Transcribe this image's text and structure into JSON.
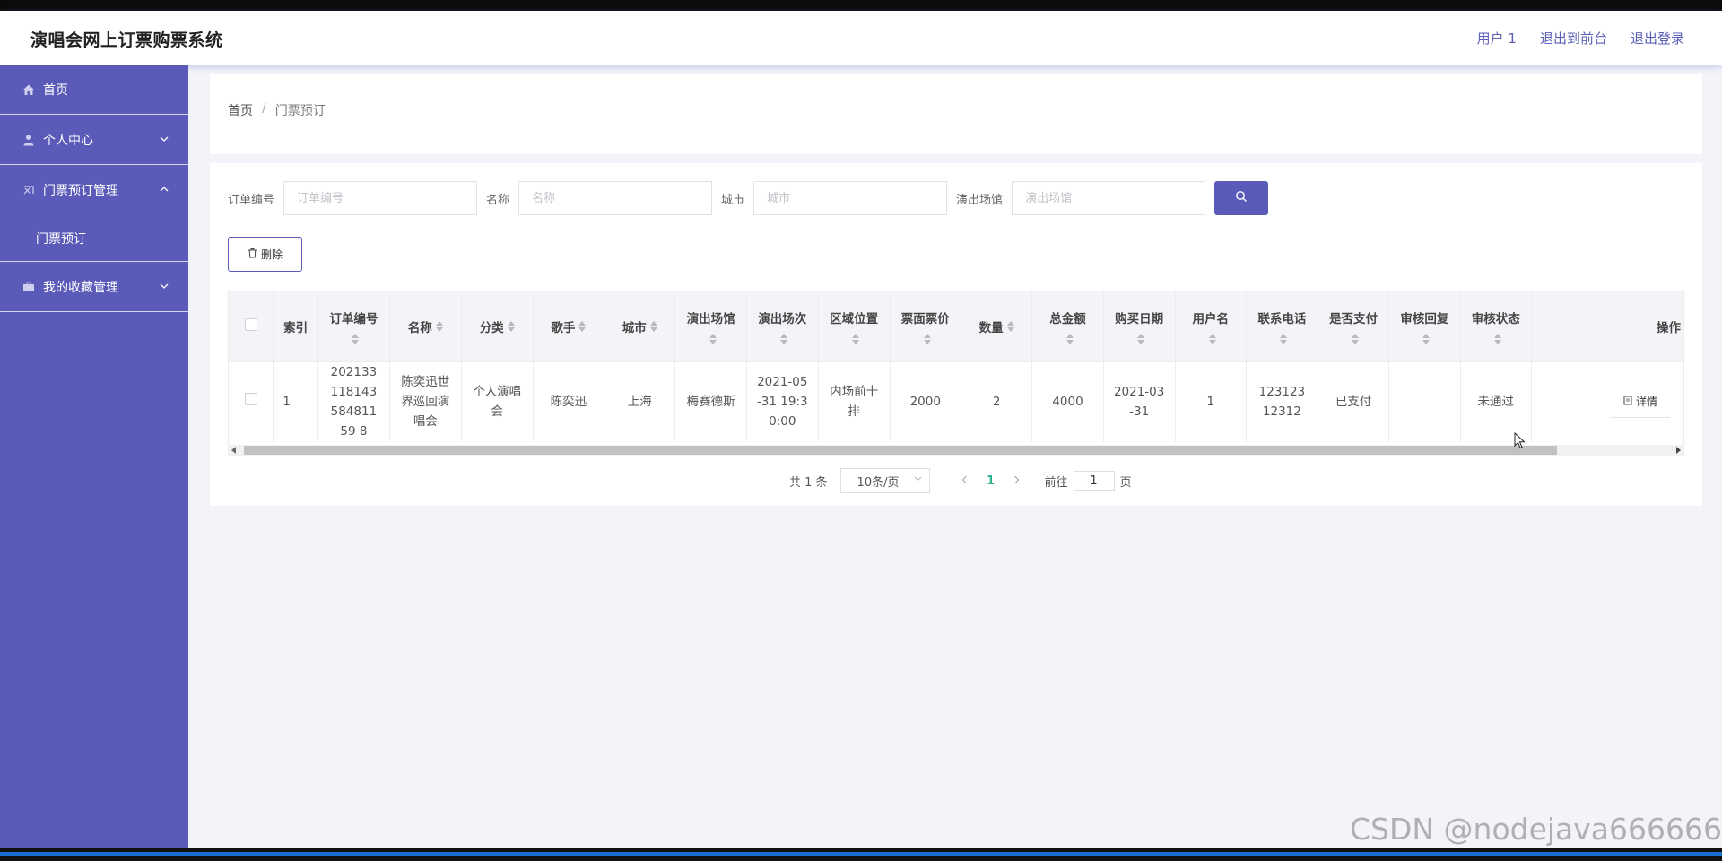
{
  "header": {
    "title": "演唱会网上订票购票系统",
    "user": "用户 1",
    "to_front": "退出到前台",
    "logout": "退出登录"
  },
  "sidebar": {
    "items": [
      {
        "label": "首页",
        "icon": "home-icon"
      },
      {
        "label": "个人中心",
        "icon": "user-icon"
      },
      {
        "label": "门票预订管理",
        "icon": "ticket-icon"
      },
      {
        "label": "门票预订",
        "icon": ""
      },
      {
        "label": "我的收藏管理",
        "icon": "briefcase-icon"
      }
    ]
  },
  "breadcrumb": {
    "home": "首页",
    "sep": "/",
    "current": "门票预订"
  },
  "search": {
    "order_label": "订单编号",
    "order_placeholder": "订单编号",
    "name_label": "名称",
    "name_placeholder": "名称",
    "city_label": "城市",
    "city_placeholder": "城市",
    "venue_label": "演出场馆",
    "venue_placeholder": "演出场馆"
  },
  "actions": {
    "delete": "删除"
  },
  "table": {
    "headers": [
      "索引",
      "订单编号",
      "名称",
      "分类",
      "歌手",
      "城市",
      "演出场馆",
      "演出场次",
      "区域位置",
      "票面票价",
      "数量",
      "总金额",
      "购买日期",
      "用户名",
      "联系电话",
      "是否支付",
      "审核回复",
      "审核状态",
      "操作"
    ],
    "row": {
      "index": "1",
      "order_no": "20213311814358481159 8",
      "name": "陈奕迅世界巡回演唱会",
      "category": "个人演唱会",
      "singer": "陈奕迅",
      "city": "上海",
      "venue": "梅赛德斯",
      "session": "2021-05-31 19:30:00",
      "area": "内场前十排",
      "price": "2000",
      "qty": "2",
      "total": "4000",
      "date": "2021-03-31",
      "username": "1",
      "phone": "12312312312",
      "paid": "已支付",
      "reply": "",
      "status": "未通过",
      "detail": "详情"
    }
  },
  "pager": {
    "total": "共 1 条",
    "size": "10条/页",
    "page": "1",
    "goto": "前往",
    "goto_value": "1",
    "unit": "页"
  },
  "watermark": "CSDN @nodejava666666",
  "colors": {
    "primary": "#5a5bb8",
    "active_page": "#2bb48f"
  }
}
